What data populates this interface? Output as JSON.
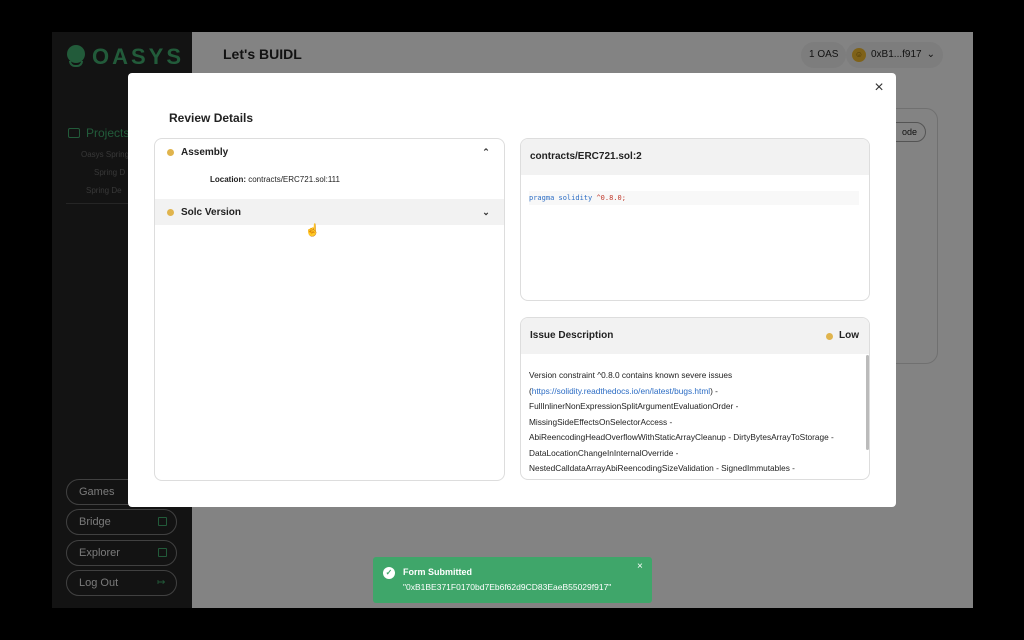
{
  "brand": {
    "name": "OASYS"
  },
  "sidebar": {
    "projects_label": "Projects",
    "sub_items": [
      "Oasys Spring",
      "Spring D",
      "Spring De"
    ],
    "buttons": [
      {
        "label": "Games",
        "icon": "none"
      },
      {
        "label": "Bridge",
        "icon": "external-link-icon"
      },
      {
        "label": "Explorer",
        "icon": "external-link-icon"
      },
      {
        "label": "Log Out",
        "icon": "logout-icon"
      }
    ]
  },
  "header": {
    "title": "Let's BUIDL",
    "balance": "1 OAS",
    "account": "0xB1...f917",
    "background_button": "ode"
  },
  "modal": {
    "title": "Review Details",
    "close": "×",
    "accordion": [
      {
        "label": "Assembly",
        "expanded": true,
        "location_label": "Location:",
        "location_value": "contracts/ERC721.sol:111"
      },
      {
        "label": "Solc Version",
        "expanded": false
      }
    ],
    "code_card": {
      "title": "contracts/ERC721.sol:2",
      "code_keyword": "pragma solidity",
      "code_value": "^0.8.0;"
    },
    "issue_card": {
      "title": "Issue Description",
      "severity": "Low",
      "text_pre": "Version constraint ^0.8.0 contains known severe issues (",
      "link": "https://solidity.readthedocs.io/en/latest/bugs.html",
      "text_post": ") - FullInlinerNonExpressionSplitArgumentEvaluationOrder - MissingSideEffectsOnSelectorAccess - AbiReencodingHeadOverflowWithStaticArrayCleanup - DirtyBytesArrayToStorage - DataLocationChangeInInternalOverride - NestedCalldataArrayAbiReencodingSizeValidation - SignedImmutables -"
    }
  },
  "toast": {
    "title": "Form Submitted",
    "message": "\"0xB1BE371F0170bd7Eb6f62d9CD83EaeB55029f917\"",
    "close": "×"
  },
  "colors": {
    "brand_green": "#3fa66a",
    "severity_low": "#e0b44d",
    "link": "#2b6cc4"
  }
}
